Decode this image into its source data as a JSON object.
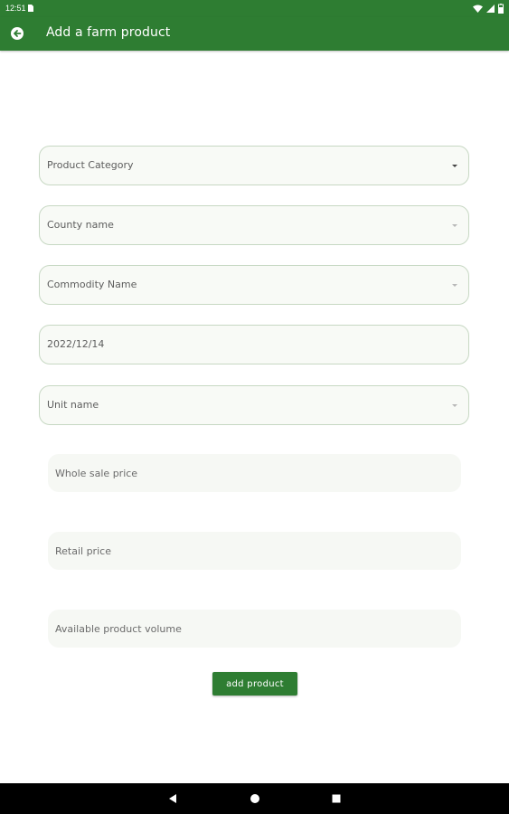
{
  "status_bar": {
    "time": "12:51"
  },
  "app_bar": {
    "title": "Add a farm product"
  },
  "form": {
    "product_category": "Product Category",
    "county_name": "County name",
    "commodity_name": "Commodity Name",
    "date": "2022/12/14",
    "unit_name": "Unit name",
    "wholesale_price_placeholder": "Whole sale price",
    "retail_price_placeholder": "Retail price",
    "volume_placeholder": "Available product volume",
    "submit_label": "add product"
  },
  "colors": {
    "primary": "#2e7d32",
    "field_border": "#c7d8c3",
    "field_background": "#f8faf6",
    "navigation_bar": "#000000"
  },
  "icons": {
    "back": "arrow-back-circle-icon",
    "dropdown": "triangle-down-icon",
    "nav_back": "triangle-left-icon",
    "nav_home": "circle-icon",
    "nav_recents": "square-icon"
  }
}
